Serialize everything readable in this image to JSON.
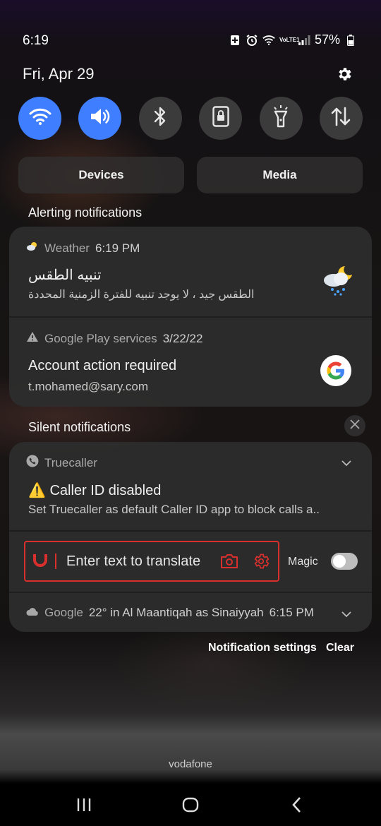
{
  "status_bar": {
    "time": "6:19",
    "battery": "57%",
    "network_label": "VoLTE1"
  },
  "header": {
    "date": "Fri, Apr 29"
  },
  "quick_settings": [
    {
      "name": "wifi",
      "active": true
    },
    {
      "name": "sound",
      "active": true
    },
    {
      "name": "bluetooth",
      "active": false
    },
    {
      "name": "portrait-lock",
      "active": false
    },
    {
      "name": "flashlight",
      "active": false
    },
    {
      "name": "mobile-data",
      "active": false
    }
  ],
  "tabs": {
    "devices": "Devices",
    "media": "Media"
  },
  "alerting": {
    "title": "Alerting notifications",
    "weather": {
      "app": "Weather",
      "time": "6:19 PM",
      "title": "تنبيه الطقس",
      "body": "الطقس جيد ، لا يوجد تنبيه للفترة الزمنية المحددة"
    },
    "gplay": {
      "app": "Google Play services",
      "time": "3/22/22",
      "title": "Account action required",
      "body": "t.mohamed@sary.com"
    }
  },
  "silent": {
    "title": "Silent notifications",
    "truecaller": {
      "app": "Truecaller",
      "title": "⚠️ Caller ID disabled",
      "body": "Set Truecaller as default Caller ID app to block calls a.."
    },
    "translate": {
      "placeholder": "Enter text to translate",
      "magic_label": "Magic",
      "magic_enabled": false
    },
    "google": {
      "app": "Google",
      "text": "22° in Al Maantiqah as Sinaiyyah",
      "time": "6:15 PM"
    }
  },
  "actions": {
    "notification_settings": "Notification settings",
    "clear": "Clear"
  },
  "carrier": "vodafone",
  "colors": {
    "accent": "#3f7eff",
    "translate_red": "#d9302d"
  }
}
